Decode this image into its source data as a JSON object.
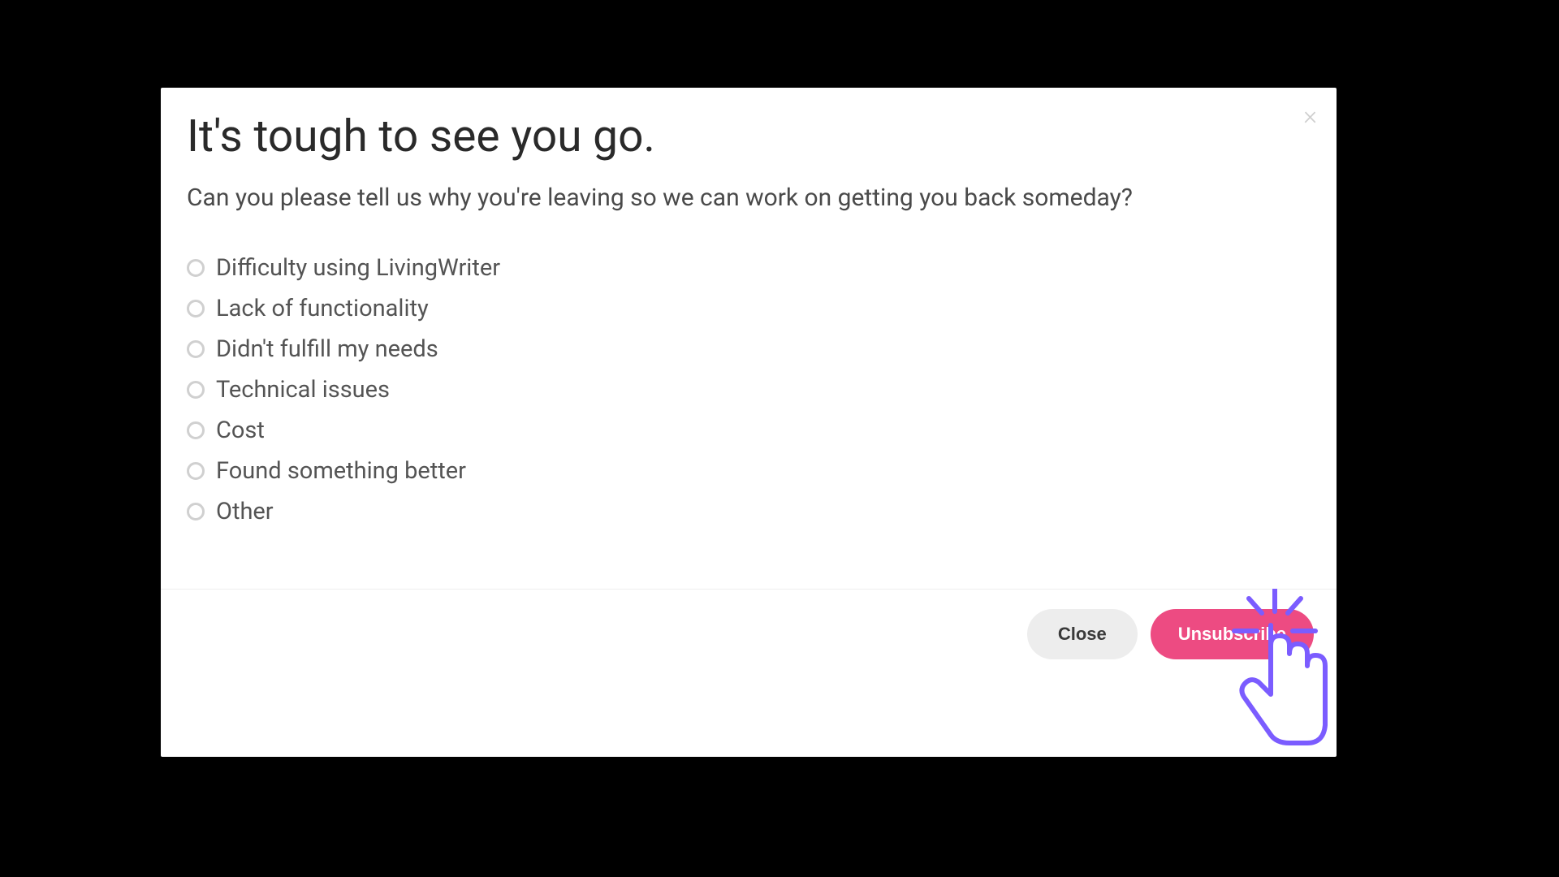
{
  "modal": {
    "title": "It's tough to see you go.",
    "subtitle": "Can you please tell us why you're leaving so we can work on getting you back someday?",
    "options": [
      "Difficulty using LivingWriter",
      "Lack of functionality",
      "Didn't fulfill my needs",
      "Technical issues",
      "Cost",
      "Found something better",
      "Other"
    ],
    "close_label": "Close",
    "unsubscribe_label": "Unsubscribe"
  }
}
